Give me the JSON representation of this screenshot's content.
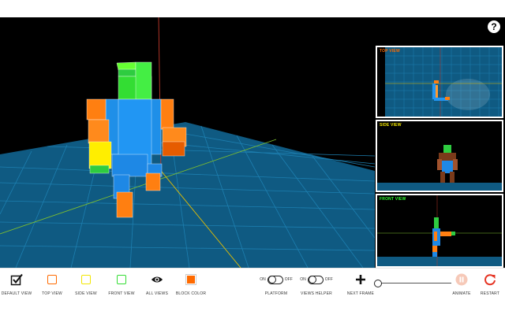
{
  "help": {
    "label": "?"
  },
  "views": {
    "top": {
      "label": "TOP VIEW",
      "color": "#ff6a00"
    },
    "side": {
      "label": "SIDE VIEW",
      "color": "#f2e600"
    },
    "front": {
      "label": "FRONT VIEW",
      "color": "#33ff33"
    }
  },
  "toolbar": {
    "default_view": "DEFAULT VIEW",
    "top_view": "TOP VIEW",
    "side_view": "SIDE VIEW",
    "front_view": "FRONT VIEW",
    "all_views": "ALL VIEWS",
    "block_color": "BLOCK COLOR",
    "platform": {
      "label": "PLATFORM",
      "on": "ON",
      "off": "OFF"
    },
    "views_helper": {
      "label": "VIEWS HELPER",
      "on": "ON",
      "off": "OFF"
    },
    "next_frame": "NEXT FRAME",
    "animate": "ANIMATE",
    "restart": "RESTART"
  },
  "frame_slider": {
    "position": 0
  },
  "colors": {
    "block_color": "#ff6a00",
    "top_square": "#ff6a00",
    "side_square": "#f2e600",
    "front_square": "#33dd33",
    "restart": "#e53322",
    "animate": "#f6c9b8",
    "grid": "#0f5a82"
  }
}
